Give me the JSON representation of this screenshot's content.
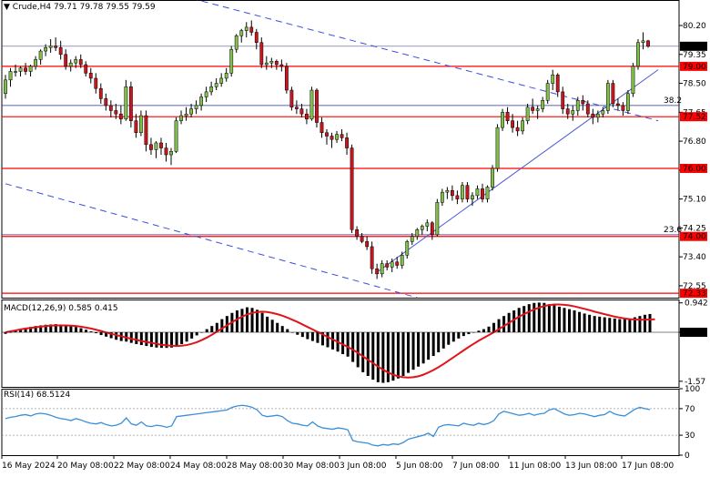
{
  "header": {
    "symbol": "Crude,H4",
    "ohlc": "79.71 79.78 79.55 79.59"
  },
  "colors": {
    "bull": "#7fbf4a",
    "bear": "#c8161d",
    "support_line": "#ff0000",
    "fib_line": "#2f2f9f",
    "channel_line": "#3a4fd6",
    "trend_line": "#4a58d0",
    "macd_signal": "#e1141b",
    "macd_hist": "#000000",
    "rsi": "#3b8fd8",
    "current_price_bg": "#000000"
  },
  "chart_data": [
    {
      "type": "candlestick",
      "title": "Crude,H4",
      "ylim": [
        72.2,
        80.95
      ],
      "y_ticks": [
        "80.20",
        "79.35",
        "78.50",
        "77.65",
        "76.80",
        "75.95",
        "75.10",
        "74.25",
        "73.40",
        "72.55"
      ],
      "price_label": "79.59",
      "horizontal_levels": [
        {
          "value": 79.0,
          "label": "79.00",
          "style": "support"
        },
        {
          "value": 77.52,
          "label": "77.52",
          "style": "support"
        },
        {
          "value": 76.0,
          "label": "76.00",
          "style": "support"
        },
        {
          "value": 74.0,
          "label": "74.00",
          "style": "support"
        },
        {
          "value": 72.33,
          "label": "72.33",
          "style": "support"
        },
        {
          "value": 77.85,
          "label": "38.2",
          "style": "fib"
        },
        {
          "value": 74.05,
          "label": "23.6",
          "style": "fib"
        },
        {
          "value": 79.59,
          "label": "79.59",
          "style": "current"
        }
      ],
      "x_labels": [
        "16 May 2024",
        "20 May 08:00",
        "22 May 08:00",
        "24 May 08:00",
        "28 May 08:00",
        "30 May 08:00",
        "3 Jun 08:00",
        "5 Jun 08:00",
        "7 Jun 08:00",
        "11 Jun 08:00",
        "13 Jun 08:00",
        "17 Jun 08:00"
      ],
      "candles": [
        [
          78.2,
          78.75,
          78.05,
          78.6
        ],
        [
          78.6,
          78.95,
          78.4,
          78.85
        ],
        [
          78.85,
          79.05,
          78.7,
          78.85
        ],
        [
          78.85,
          79.0,
          78.7,
          78.95
        ],
        [
          78.95,
          79.1,
          78.75,
          78.85
        ],
        [
          78.85,
          79.05,
          78.7,
          79.0
        ],
        [
          79.0,
          79.3,
          78.9,
          79.2
        ],
        [
          79.2,
          79.5,
          79.05,
          79.45
        ],
        [
          79.45,
          79.65,
          79.3,
          79.55
        ],
        [
          79.55,
          79.8,
          79.4,
          79.6
        ],
        [
          79.6,
          79.85,
          79.45,
          79.55
        ],
        [
          79.55,
          79.75,
          79.2,
          79.35
        ],
        [
          79.35,
          79.5,
          78.9,
          79.0
        ],
        [
          79.0,
          79.2,
          78.85,
          79.1
        ],
        [
          79.1,
          79.3,
          78.95,
          79.2
        ],
        [
          79.2,
          79.35,
          78.95,
          79.05
        ],
        [
          79.05,
          79.15,
          78.7,
          78.8
        ],
        [
          78.8,
          78.95,
          78.5,
          78.65
        ],
        [
          78.65,
          78.8,
          78.2,
          78.35
        ],
        [
          78.35,
          78.5,
          77.9,
          78.05
        ],
        [
          78.05,
          78.2,
          77.7,
          77.85
        ],
        [
          77.85,
          78.0,
          77.5,
          77.7
        ],
        [
          77.7,
          77.9,
          77.45,
          77.6
        ],
        [
          77.6,
          77.85,
          77.3,
          77.45
        ],
        [
          77.45,
          78.6,
          77.4,
          78.4
        ],
        [
          78.4,
          78.55,
          77.2,
          77.4
        ],
        [
          77.4,
          77.6,
          76.9,
          77.05
        ],
        [
          77.05,
          77.7,
          76.95,
          77.55
        ],
        [
          77.55,
          77.7,
          76.5,
          76.7
        ],
        [
          76.7,
          76.9,
          76.4,
          76.55
        ],
        [
          76.55,
          76.8,
          76.3,
          76.75
        ],
        [
          76.75,
          76.9,
          76.4,
          76.6
        ],
        [
          76.6,
          76.75,
          76.2,
          76.4
        ],
        [
          76.4,
          76.6,
          76.1,
          76.5
        ],
        [
          76.5,
          77.5,
          76.45,
          77.4
        ],
        [
          77.4,
          77.7,
          77.3,
          77.55
        ],
        [
          77.55,
          77.8,
          77.4,
          77.6
        ],
        [
          77.6,
          77.9,
          77.5,
          77.75
        ],
        [
          77.75,
          78.0,
          77.6,
          77.85
        ],
        [
          77.85,
          78.2,
          77.7,
          78.1
        ],
        [
          78.1,
          78.4,
          77.95,
          78.25
        ],
        [
          78.25,
          78.55,
          78.15,
          78.4
        ],
        [
          78.4,
          78.65,
          78.3,
          78.5
        ],
        [
          78.5,
          78.8,
          78.4,
          78.65
        ],
        [
          78.65,
          78.95,
          78.55,
          78.8
        ],
        [
          78.8,
          79.6,
          78.7,
          79.5
        ],
        [
          79.5,
          79.95,
          79.4,
          79.9
        ],
        [
          79.9,
          80.1,
          79.7,
          80.05
        ],
        [
          80.05,
          80.3,
          79.85,
          80.15
        ],
        [
          80.15,
          80.35,
          79.9,
          80.0
        ],
        [
          80.0,
          80.1,
          79.5,
          79.7
        ],
        [
          79.7,
          79.85,
          78.95,
          79.05
        ],
        [
          79.05,
          79.3,
          78.9,
          79.1
        ],
        [
          79.1,
          79.25,
          78.95,
          79.15
        ],
        [
          79.15,
          79.2,
          78.9,
          79.05
        ],
        [
          79.05,
          79.2,
          78.85,
          79.0
        ],
        [
          79.0,
          79.1,
          78.2,
          78.3
        ],
        [
          78.3,
          78.4,
          77.7,
          77.8
        ],
        [
          77.8,
          78.0,
          77.6,
          77.75
        ],
        [
          77.75,
          77.9,
          77.5,
          77.6
        ],
        [
          77.6,
          77.75,
          77.3,
          77.45
        ],
        [
          77.45,
          78.4,
          77.4,
          78.3
        ],
        [
          78.3,
          78.35,
          77.2,
          77.35
        ],
        [
          77.35,
          77.5,
          76.9,
          77.05
        ],
        [
          77.05,
          77.15,
          76.7,
          76.95
        ],
        [
          76.95,
          77.05,
          76.6,
          76.85
        ],
        [
          76.85,
          77.1,
          76.75,
          77.0
        ],
        [
          77.0,
          77.15,
          76.8,
          76.9
        ],
        [
          76.9,
          77.05,
          76.4,
          76.6
        ],
        [
          76.6,
          76.7,
          74.1,
          74.2
        ],
        [
          74.2,
          74.3,
          73.9,
          74.0
        ],
        [
          74.0,
          74.1,
          73.8,
          73.85
        ],
        [
          73.85,
          74.0,
          73.6,
          73.7
        ],
        [
          73.7,
          73.85,
          72.9,
          73.05
        ],
        [
          73.05,
          73.2,
          72.75,
          72.9
        ],
        [
          72.9,
          73.3,
          72.8,
          73.2
        ],
        [
          73.2,
          73.3,
          73.0,
          73.1
        ],
        [
          73.1,
          73.35,
          72.95,
          73.25
        ],
        [
          73.25,
          73.4,
          73.05,
          73.15
        ],
        [
          73.15,
          73.55,
          73.05,
          73.45
        ],
        [
          73.45,
          73.9,
          73.35,
          73.85
        ],
        [
          73.85,
          74.1,
          73.75,
          74.0
        ],
        [
          74.0,
          74.25,
          73.9,
          74.2
        ],
        [
          74.2,
          74.35,
          74.05,
          74.3
        ],
        [
          74.3,
          74.5,
          74.15,
          74.4
        ],
        [
          74.4,
          74.45,
          73.9,
          74.05
        ],
        [
          74.05,
          75.1,
          74.0,
          75.0
        ],
        [
          75.0,
          75.4,
          74.9,
          75.3
        ],
        [
          75.3,
          75.45,
          75.1,
          75.35
        ],
        [
          75.35,
          75.5,
          75.05,
          75.2
        ],
        [
          75.2,
          75.35,
          74.95,
          75.1
        ],
        [
          75.1,
          75.6,
          75.0,
          75.5
        ],
        [
          75.5,
          75.6,
          75.0,
          75.1
        ],
        [
          75.1,
          75.3,
          74.9,
          75.2
        ],
        [
          75.2,
          75.5,
          75.1,
          75.4
        ],
        [
          75.4,
          75.55,
          75.0,
          75.1
        ],
        [
          75.1,
          75.5,
          75.0,
          75.45
        ],
        [
          75.45,
          76.1,
          75.35,
          76.0
        ],
        [
          76.0,
          77.3,
          75.9,
          77.2
        ],
        [
          77.2,
          77.75,
          77.1,
          77.65
        ],
        [
          77.65,
          77.8,
          77.3,
          77.4
        ],
        [
          77.4,
          77.6,
          77.05,
          77.2
        ],
        [
          77.2,
          77.4,
          76.95,
          77.1
        ],
        [
          77.1,
          77.5,
          77.0,
          77.4
        ],
        [
          77.4,
          77.9,
          77.3,
          77.8
        ],
        [
          77.8,
          78.05,
          77.6,
          77.7
        ],
        [
          77.7,
          77.85,
          77.45,
          77.75
        ],
        [
          77.75,
          78.1,
          77.65,
          78.0
        ],
        [
          78.0,
          78.6,
          77.9,
          78.5
        ],
        [
          78.5,
          78.9,
          78.3,
          78.75
        ],
        [
          78.75,
          78.8,
          78.1,
          78.25
        ],
        [
          78.25,
          78.4,
          77.6,
          77.75
        ],
        [
          77.75,
          77.9,
          77.45,
          77.6
        ],
        [
          77.6,
          77.85,
          77.4,
          77.7
        ],
        [
          77.7,
          78.1,
          77.55,
          78.0
        ],
        [
          78.0,
          78.15,
          77.7,
          77.9
        ],
        [
          77.9,
          78.0,
          77.5,
          77.6
        ],
        [
          77.6,
          77.75,
          77.3,
          77.5
        ],
        [
          77.5,
          77.7,
          77.35,
          77.6
        ],
        [
          77.6,
          77.8,
          77.5,
          77.7
        ],
        [
          77.7,
          78.6,
          77.6,
          78.5
        ],
        [
          78.5,
          78.6,
          77.8,
          77.9
        ],
        [
          77.9,
          78.05,
          77.7,
          77.85
        ],
        [
          77.85,
          77.95,
          77.55,
          77.7
        ],
        [
          77.7,
          78.3,
          77.6,
          78.2
        ],
        [
          78.2,
          79.1,
          78.1,
          79.0
        ],
        [
          79.0,
          79.8,
          78.9,
          79.7
        ],
        [
          79.7,
          80.0,
          79.5,
          79.75
        ],
        [
          79.75,
          79.78,
          79.55,
          79.59
        ]
      ]
    },
    {
      "type": "bar",
      "title": "MACD(12,26,9)",
      "header_values": "0.585 0.415",
      "ylim": [
        -1.75,
        1.05
      ],
      "y_ticks": [
        "0.942",
        "0.00",
        "-1.57"
      ],
      "hist": [
        -0.05,
        0,
        0.05,
        0.1,
        0.14,
        0.17,
        0.2,
        0.22,
        0.24,
        0.25,
        0.26,
        0.25,
        0.23,
        0.2,
        0.17,
        0.13,
        0.08,
        0.03,
        -0.03,
        -0.09,
        -0.14,
        -0.19,
        -0.24,
        -0.28,
        -0.3,
        -0.34,
        -0.38,
        -0.41,
        -0.44,
        -0.47,
        -0.49,
        -0.5,
        -0.5,
        -0.49,
        -0.45,
        -0.38,
        -0.3,
        -0.2,
        -0.1,
        0.0,
        0.1,
        0.2,
        0.3,
        0.42,
        0.52,
        0.62,
        0.7,
        0.75,
        0.8,
        0.78,
        0.72,
        0.62,
        0.5,
        0.4,
        0.3,
        0.2,
        0.1,
        0.0,
        -0.08,
        -0.15,
        -0.22,
        -0.28,
        -0.34,
        -0.42,
        -0.48,
        -0.55,
        -0.62,
        -0.7,
        -0.78,
        -0.95,
        -1.12,
        -1.28,
        -1.4,
        -1.52,
        -1.6,
        -1.62,
        -1.6,
        -1.55,
        -1.48,
        -1.4,
        -1.3,
        -1.2,
        -1.1,
        -1.0,
        -0.88,
        -0.76,
        -0.64,
        -0.52,
        -0.4,
        -0.3,
        -0.2,
        -0.12,
        -0.06,
        0.0,
        0.05,
        0.1,
        0.18,
        0.3,
        0.42,
        0.52,
        0.62,
        0.7,
        0.78,
        0.84,
        0.9,
        0.94,
        0.95,
        0.94,
        0.9,
        0.86,
        0.82,
        0.78,
        0.74,
        0.7,
        0.65,
        0.6,
        0.56,
        0.52,
        0.5,
        0.48,
        0.46,
        0.44,
        0.42,
        0.42,
        0.44,
        0.48,
        0.52,
        0.56,
        0.585
      ],
      "signal": [
        0.0,
        0.03,
        0.06,
        0.09,
        0.12,
        0.14,
        0.16,
        0.18,
        0.2,
        0.21,
        0.22,
        0.22,
        0.22,
        0.21,
        0.2,
        0.18,
        0.15,
        0.12,
        0.08,
        0.04,
        -0.01,
        -0.05,
        -0.09,
        -0.13,
        -0.17,
        -0.21,
        -0.24,
        -0.28,
        -0.31,
        -0.34,
        -0.37,
        -0.4,
        -0.42,
        -0.43,
        -0.44,
        -0.43,
        -0.41,
        -0.37,
        -0.32,
        -0.25,
        -0.17,
        -0.08,
        0.02,
        0.12,
        0.22,
        0.32,
        0.42,
        0.5,
        0.57,
        0.62,
        0.65,
        0.66,
        0.65,
        0.62,
        0.58,
        0.53,
        0.47,
        0.4,
        0.33,
        0.25,
        0.17,
        0.09,
        0.01,
        -0.07,
        -0.15,
        -0.23,
        -0.31,
        -0.39,
        -0.47,
        -0.56,
        -0.66,
        -0.77,
        -0.88,
        -0.99,
        -1.1,
        -1.2,
        -1.29,
        -1.36,
        -1.41,
        -1.44,
        -1.45,
        -1.44,
        -1.41,
        -1.36,
        -1.29,
        -1.21,
        -1.12,
        -1.02,
        -0.91,
        -0.8,
        -0.69,
        -0.58,
        -0.47,
        -0.37,
        -0.27,
        -0.18,
        -0.09,
        0.0,
        0.1,
        0.2,
        0.3,
        0.4,
        0.5,
        0.58,
        0.66,
        0.73,
        0.79,
        0.84,
        0.87,
        0.89,
        0.89,
        0.88,
        0.86,
        0.83,
        0.79,
        0.75,
        0.71,
        0.66,
        0.62,
        0.58,
        0.54,
        0.5,
        0.47,
        0.44,
        0.42,
        0.41,
        0.4,
        0.4,
        0.41,
        0.415
      ]
    },
    {
      "type": "line",
      "title": "RSI(14)",
      "header_values": "68.5124",
      "ylim": [
        0,
        100
      ],
      "y_ticks": [
        "100",
        "70",
        "30",
        "0"
      ],
      "levels": [
        70,
        30
      ],
      "values": [
        55,
        57,
        58,
        60,
        61,
        59,
        62,
        63,
        62,
        60,
        57,
        55,
        54,
        52,
        55,
        53,
        50,
        48,
        47,
        49,
        46,
        44,
        45,
        48,
        56,
        47,
        45,
        50,
        44,
        43,
        45,
        44,
        42,
        44,
        58,
        59,
        60,
        61,
        62,
        63,
        64,
        65,
        66,
        67,
        68,
        72,
        74,
        75,
        74,
        72,
        68,
        60,
        58,
        59,
        60,
        58,
        52,
        48,
        47,
        45,
        44,
        50,
        44,
        41,
        40,
        39,
        41,
        40,
        38,
        22,
        20,
        19,
        18,
        15,
        14,
        16,
        15,
        17,
        16,
        19,
        24,
        26,
        28,
        30,
        33,
        28,
        42,
        45,
        46,
        45,
        44,
        48,
        46,
        45,
        48,
        46,
        48,
        52,
        62,
        66,
        64,
        62,
        60,
        61,
        63,
        60,
        62,
        63,
        68,
        70,
        66,
        62,
        60,
        61,
        63,
        62,
        60,
        58,
        60,
        61,
        66,
        62,
        60,
        59,
        64,
        69,
        72,
        70,
        68.5
      ]
    }
  ]
}
